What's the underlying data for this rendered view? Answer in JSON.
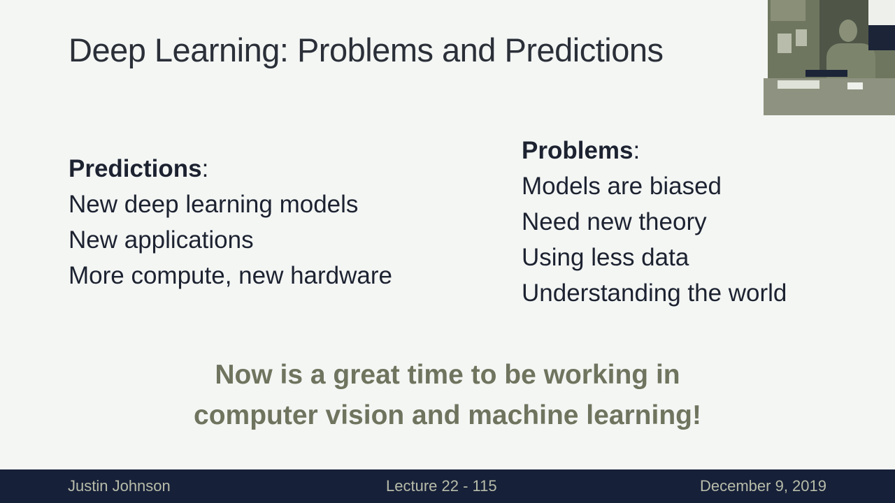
{
  "slide": {
    "title": "Deep Learning: Problems and Predictions",
    "predictions": {
      "heading": "Predictions",
      "items": [
        "New deep learning models",
        "New applications",
        "More compute, new hardware"
      ]
    },
    "problems": {
      "heading": "Problems",
      "items": [
        "Models are biased",
        "Need new theory",
        "Using less data",
        "Understanding the world"
      ]
    },
    "message": [
      "Now is a great time to be working in",
      "computer vision and machine learning!"
    ],
    "colon": ":"
  },
  "footer": {
    "author": "Justin Johnson",
    "lecture": "Lecture 22 - 115",
    "date": "December 9, 2019"
  },
  "colors": {
    "background": "#f4f6f4",
    "footer": "#162038",
    "message": "#6e745e"
  }
}
